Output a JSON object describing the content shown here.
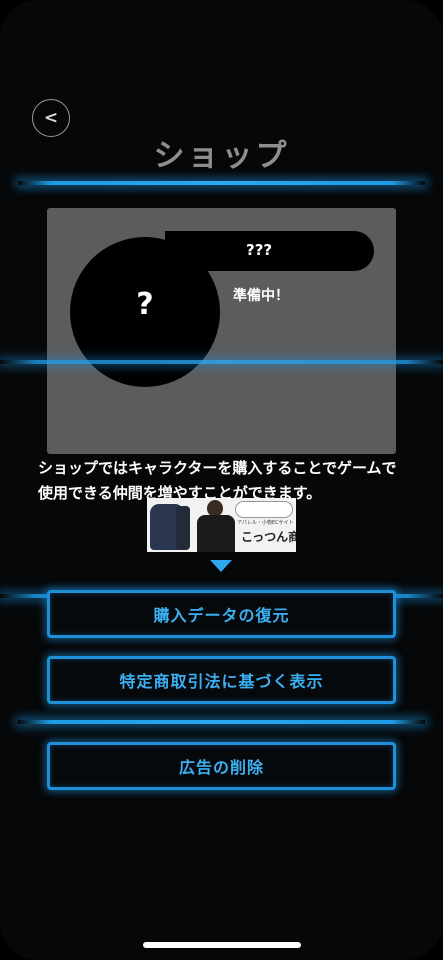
{
  "header": {
    "back_label": "<",
    "title": "ショップ"
  },
  "character_panel": {
    "placeholder_symbol": "?",
    "name": "???",
    "status": "準備中！"
  },
  "description": "ショップではキャラクターを購入することでゲームで使用できる仲間を増やすことができます。",
  "ad_banner": {
    "caption": "アパレル・小物ECサイト",
    "brand": "こっつん商店"
  },
  "buttons": {
    "restore": "購入データの復元",
    "legal": "特定商取引法に基づく表示",
    "remove_ads": "広告の削除"
  },
  "colors": {
    "accent": "#1e9be6",
    "button_text": "#3cb0f2",
    "panel": "#5c5c5c"
  }
}
